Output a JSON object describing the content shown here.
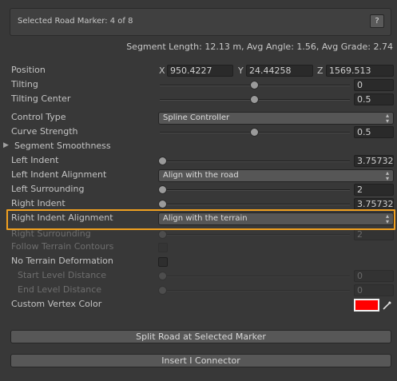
{
  "header": {
    "title": "Selected Road Marker: 4 of 8",
    "help_label": "?"
  },
  "segment_info": "Segment Length: 12.13 m, Avg Angle: 1.56, Avg Grade: 2.74",
  "position": {
    "label": "Position",
    "x_label": "X",
    "x": "950.4227",
    "y_label": "Y",
    "y": "24.44258",
    "z_label": "Z",
    "z": "1569.513"
  },
  "tilting": {
    "label": "Tilting",
    "value": "0",
    "slider": 0.5
  },
  "tilting_center": {
    "label": "Tilting Center",
    "value": "0.5",
    "slider": 0.5
  },
  "control_type": {
    "label": "Control Type",
    "selected": "Spline Controller"
  },
  "curve_strength": {
    "label": "Curve Strength",
    "value": "0.5",
    "slider": 0.5
  },
  "segment_smoothness": {
    "label": "Segment Smoothness"
  },
  "left_indent": {
    "label": "Left Indent",
    "value": "3.75732",
    "slider": 0.01
  },
  "left_indent_alignment": {
    "label": "Left Indent Alignment",
    "selected": "Align with the road"
  },
  "left_surrounding": {
    "label": "Left Surrounding",
    "value": "2",
    "slider": 0.01
  },
  "right_indent": {
    "label": "Right Indent",
    "value": "3.75732",
    "slider": 0.01
  },
  "right_indent_alignment": {
    "label": "Right Indent Alignment",
    "selected": "Align with the terrain"
  },
  "right_surrounding": {
    "label": "Right Surrounding",
    "value": "2",
    "slider": 0.01
  },
  "follow_terrain_contours": {
    "label": "Follow Terrain Contours",
    "checked": false
  },
  "no_terrain_deformation": {
    "label": "No Terrain Deformation",
    "checked": false
  },
  "start_level_distance": {
    "label": "Start Level Distance",
    "value": "0",
    "slider": 0.0
  },
  "end_level_distance": {
    "label": "End Level Distance",
    "value": "0",
    "slider": 0.0
  },
  "custom_vertex_color": {
    "label": "Custom Vertex Color",
    "color": "#ff0000"
  },
  "buttons": {
    "split_road": "Split Road at Selected Marker",
    "insert_connector": "Insert I Connector"
  },
  "colors": {
    "highlight": "#f0a020"
  }
}
